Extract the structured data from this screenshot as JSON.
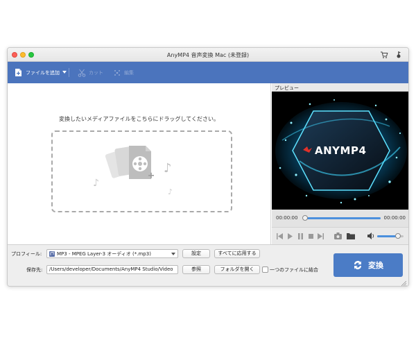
{
  "window": {
    "title": "AnyMP4 音声変換 Mac (未登録)"
  },
  "toolbar": {
    "add_file": "ファイルを追加",
    "cut": "カット",
    "edit": "編集"
  },
  "main": {
    "drop_hint": "変換したいメディアファイルをこちらにドラッグしてください。"
  },
  "preview": {
    "header": "プレビュー",
    "brand_text": "ANYMP4",
    "time_start": "00:00:00",
    "time_end": "00:00:00",
    "progress": 0,
    "volume": 0.8
  },
  "bottom": {
    "profile_label": "プロフィール:",
    "profile_value": "MP3 - MPEG Layer-3 オーディオ (*.mp3)",
    "settings_button": "設定",
    "apply_all_button": "すべてに応用する",
    "save_label": "保存先:",
    "save_path": "/Users/developer/Documents/AnyMP4 Studio/Video",
    "browse_button": "参照",
    "open_folder_button": "フォルダを開く",
    "merge_label": "一つのファイルに結合",
    "convert_button": "変換"
  },
  "colors": {
    "accent": "#4b74bd",
    "convert": "#4b7cc6"
  }
}
